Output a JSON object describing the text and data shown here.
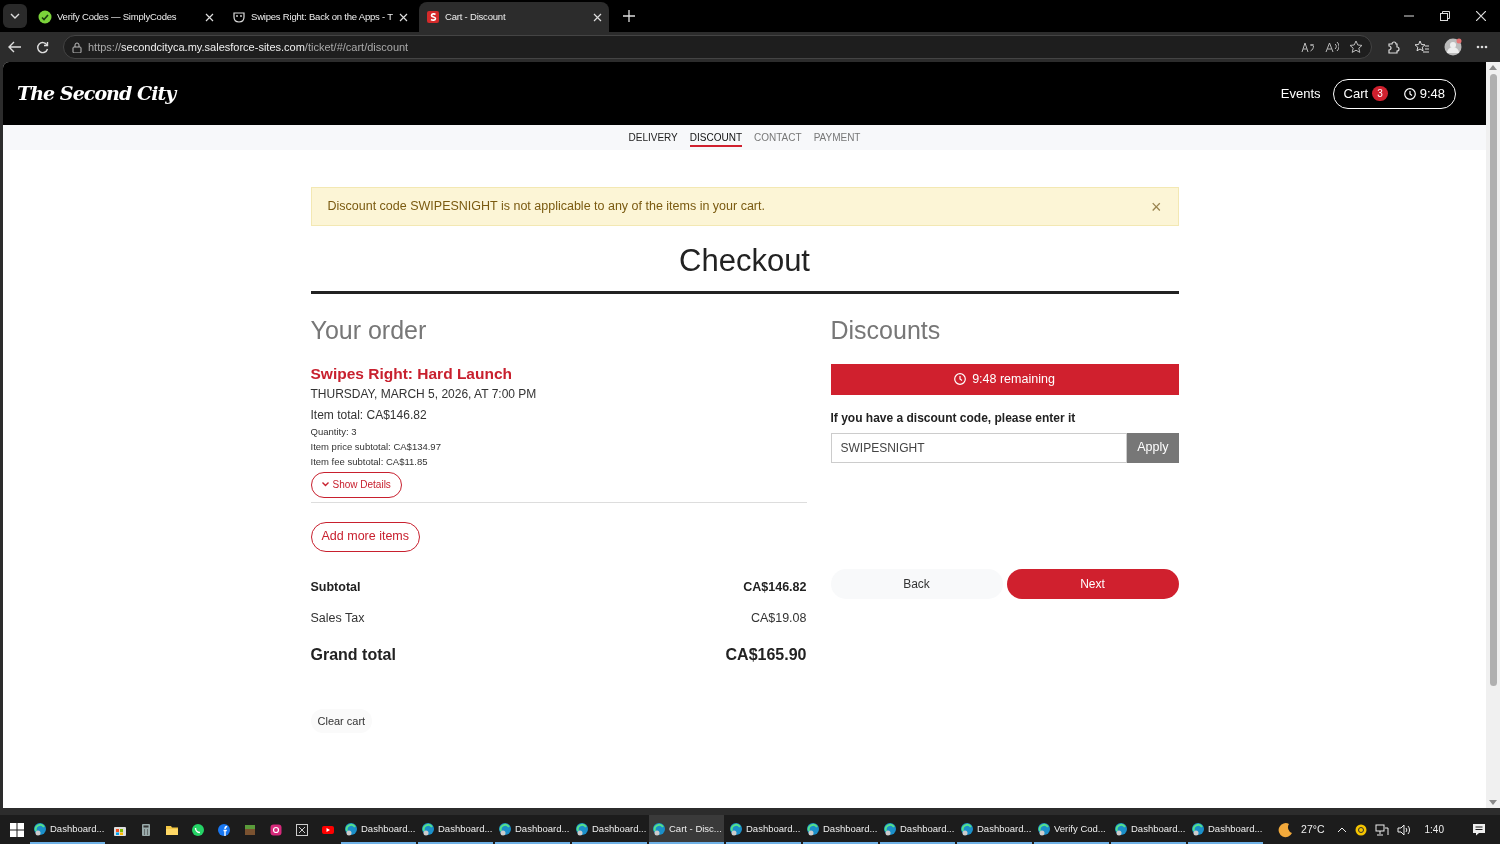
{
  "browser": {
    "tabs": [
      {
        "title": "Verify Codes — SimplyCodes",
        "selected": false,
        "kind": "check"
      },
      {
        "title": "Swipes Right: Back on the Apps - T",
        "selected": false,
        "kind": "theatre"
      },
      {
        "title": "Cart - Discount",
        "selected": true,
        "kind": "brand"
      }
    ],
    "url": {
      "scheme": "https://",
      "host": "secondcityca.my.salesforce-sites.com",
      "path": "/ticket/#/cart/discount"
    }
  },
  "site": {
    "logo": "The Second City",
    "nav": {
      "events": "Events",
      "cart": "Cart",
      "cart_count": "3",
      "timer": "9:48"
    },
    "steps": [
      {
        "label": "DELIVERY",
        "selected": false,
        "done": true
      },
      {
        "label": "DISCOUNT",
        "selected": true,
        "done": false
      },
      {
        "label": "CONTACT",
        "selected": false,
        "done": false
      },
      {
        "label": "PAYMENT",
        "selected": false,
        "done": false
      }
    ]
  },
  "alert": {
    "message": "Discount code SWIPESNIGHT is not applicable to any of the items in your cart.",
    "close": "×"
  },
  "title": "Checkout",
  "order": {
    "heading": "Your order",
    "item": {
      "name": "Swipes Right: Hard Launch",
      "date": "THURSDAY, MARCH 5, 2026, AT 7:00 PM",
      "total": "Item total: CA$146.82",
      "details": [
        "Quantity: 3",
        "Item price subtotal: CA$134.97",
        "Item fee subtotal: CA$11.85"
      ],
      "show_details": "Show Details"
    },
    "add_more": "Add more items",
    "totals": [
      {
        "label": "Subtotal",
        "value": "CA$146.82",
        "kind": "bold"
      },
      {
        "label": "Sales Tax",
        "value": "CA$19.08",
        "kind": "plain"
      },
      {
        "label": "Grand total",
        "value": "CA$165.90",
        "kind": "grand"
      }
    ],
    "clear_cart": "Clear cart"
  },
  "discounts": {
    "heading": "Discounts",
    "remaining": "9:48 remaining",
    "prompt": "If you have a discount code, please enter it",
    "code": "SWIPESNIGHT",
    "apply": "Apply",
    "back": "Back",
    "next": "Next"
  },
  "taskbar": {
    "items": [
      {
        "kind": "app",
        "label": "Dashboard...",
        "selected": false
      },
      {
        "kind": "pinned",
        "selected": false
      },
      {
        "kind": "pinned",
        "selected": false
      },
      {
        "kind": "pinned",
        "selected": false
      },
      {
        "kind": "pinned",
        "selected": false
      },
      {
        "kind": "pinned",
        "selected": false
      },
      {
        "kind": "pinned",
        "selected": false
      },
      {
        "kind": "pinned",
        "selected": false
      },
      {
        "kind": "pinned",
        "selected": false
      },
      {
        "kind": "pinned",
        "selected": false
      },
      {
        "kind": "app",
        "label": "Dashboard...",
        "selected": false
      },
      {
        "kind": "app",
        "label": "Dashboard...",
        "selected": false
      },
      {
        "kind": "app",
        "label": "Dashboard...",
        "selected": false
      },
      {
        "kind": "app",
        "label": "Dashboard...",
        "selected": false
      },
      {
        "kind": "app",
        "label": "Cart - Disc...",
        "selected": true
      },
      {
        "kind": "app",
        "label": "Dashboard...",
        "selected": false
      },
      {
        "kind": "app",
        "label": "Dashboard...",
        "selected": false
      },
      {
        "kind": "app",
        "label": "Dashboard...",
        "selected": false
      },
      {
        "kind": "app",
        "label": "Dashboard...",
        "selected": false
      },
      {
        "kind": "app",
        "label": "Verify Cod...",
        "selected": false
      },
      {
        "kind": "app",
        "label": "Dashboard...",
        "selected": false
      },
      {
        "kind": "app",
        "label": "Dashboard...",
        "selected": false
      }
    ],
    "weather": "27°C",
    "time": "1:40"
  }
}
